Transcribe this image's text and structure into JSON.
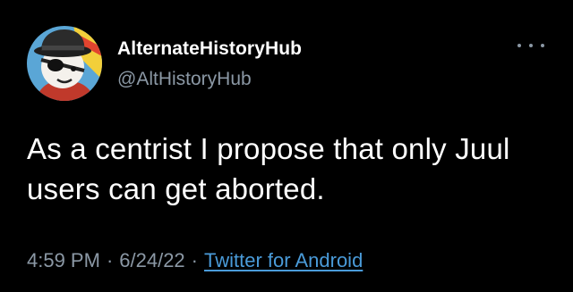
{
  "author": {
    "display_name": "AlternateHistoryHub",
    "handle": "@AltHistoryHub",
    "avatar_icon": "avatar-cartoon-icon"
  },
  "tweet": {
    "text": "As a centrist I propose that only Juul users can get aborted."
  },
  "meta": {
    "time": "4:59 PM",
    "date": "6/24/22",
    "separator": "·",
    "source": "Twitter for Android"
  },
  "colors": {
    "background": "#000000",
    "primary_text": "#ffffff",
    "secondary_text": "#8b98a5",
    "link": "#4a9bd9"
  },
  "icons": {
    "more": "more-options-icon"
  }
}
